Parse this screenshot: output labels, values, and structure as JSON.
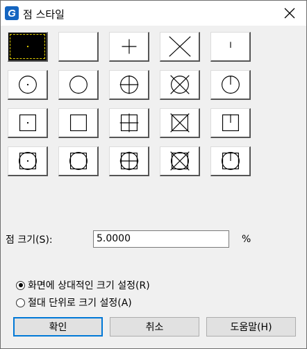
{
  "window": {
    "title": "점 스타일",
    "close_symbol": "✕"
  },
  "point_styles": [
    {
      "id": "dot-selected",
      "selected": true
    },
    {
      "id": "none",
      "selected": false
    },
    {
      "id": "plus",
      "selected": false
    },
    {
      "id": "x",
      "selected": false
    },
    {
      "id": "tick",
      "selected": false
    },
    {
      "id": "circle-dot",
      "selected": false
    },
    {
      "id": "circle",
      "selected": false
    },
    {
      "id": "circle-plus",
      "selected": false
    },
    {
      "id": "circle-x",
      "selected": false
    },
    {
      "id": "circle-tick",
      "selected": false
    },
    {
      "id": "square-dot",
      "selected": false
    },
    {
      "id": "square",
      "selected": false
    },
    {
      "id": "square-plus",
      "selected": false
    },
    {
      "id": "square-x",
      "selected": false
    },
    {
      "id": "square-tick",
      "selected": false
    },
    {
      "id": "sqcircle-dot",
      "selected": false
    },
    {
      "id": "sqcircle",
      "selected": false
    },
    {
      "id": "sqcircle-plus",
      "selected": false
    },
    {
      "id": "sqcircle-x",
      "selected": false
    },
    {
      "id": "sqcircle-tick",
      "selected": false
    }
  ],
  "size": {
    "label": "점 크기(S):",
    "value": "5.0000",
    "unit": "%"
  },
  "mode": {
    "relative": {
      "label": "화면에 상대적인 크기 설정(R)",
      "checked": true
    },
    "absolute": {
      "label": "절대 단위로 크기 설정(A)",
      "checked": false
    }
  },
  "buttons": {
    "ok": "확인",
    "cancel": "취소",
    "help": "도움말(H)"
  }
}
